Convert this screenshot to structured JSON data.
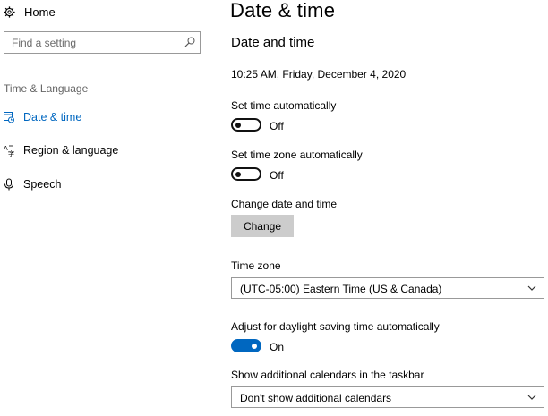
{
  "sidebar": {
    "home_label": "Home",
    "search_placeholder": "Find a setting",
    "section_label": "Time & Language",
    "items": [
      {
        "label": "Date & time",
        "icon": "clock-calendar-icon",
        "active": true
      },
      {
        "label": "Region & language",
        "icon": "language-icon",
        "active": false
      },
      {
        "label": "Speech",
        "icon": "microphone-icon",
        "active": false
      }
    ]
  },
  "main": {
    "title": "Date & time",
    "section_heading": "Date and time",
    "current_datetime": "10:25 AM, Friday, December 4, 2020",
    "set_time_auto": {
      "label": "Set time automatically",
      "state": "Off"
    },
    "set_timezone_auto": {
      "label": "Set time zone automatically",
      "state": "Off"
    },
    "change_date_time": {
      "label": "Change date and time",
      "button": "Change"
    },
    "time_zone": {
      "label": "Time zone",
      "value": "(UTC-05:00) Eastern Time (US & Canada)"
    },
    "daylight_saving": {
      "label": "Adjust for daylight saving time automatically",
      "state": "On"
    },
    "additional_calendars": {
      "label": "Show additional calendars in the taskbar",
      "value": "Don't show additional calendars"
    }
  },
  "colors": {
    "accent": "#0067c0",
    "button_bg": "#cccccc",
    "border": "#999999",
    "muted_text": "#666666"
  }
}
